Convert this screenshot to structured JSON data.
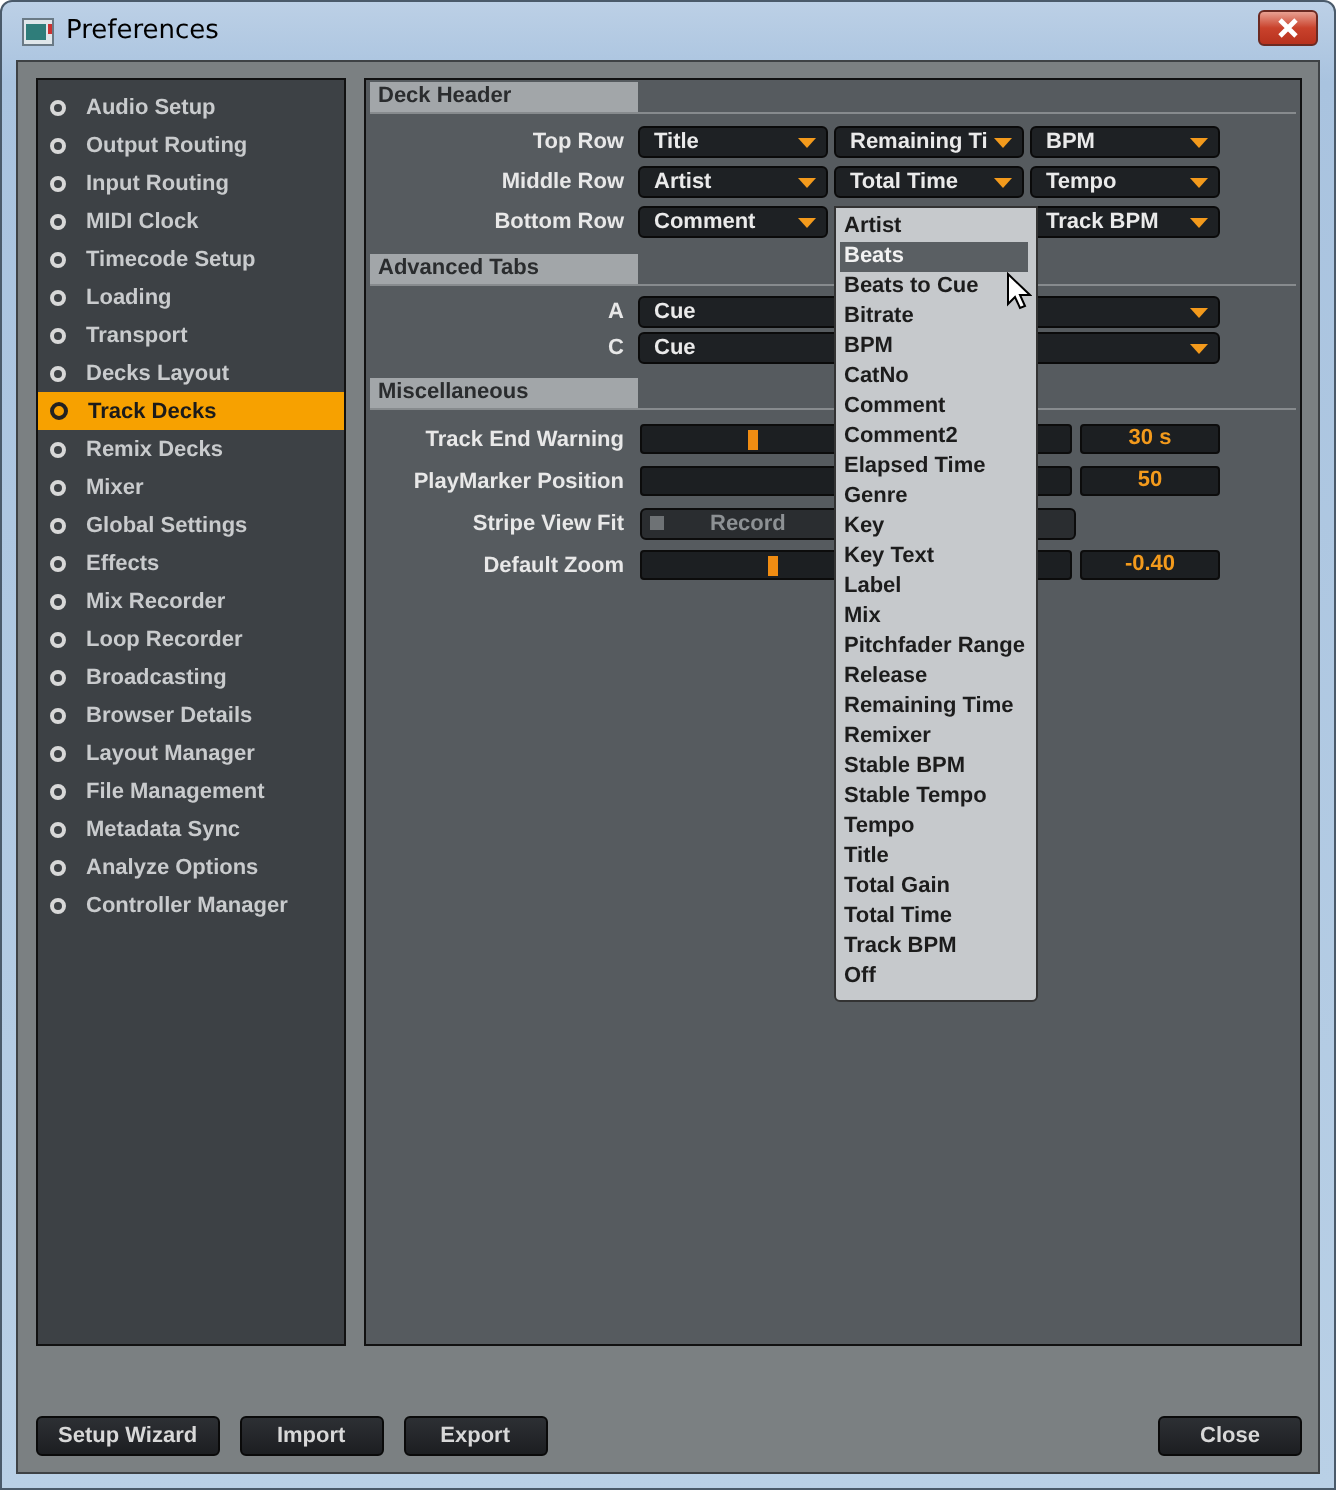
{
  "window": {
    "title": "Preferences"
  },
  "sidebar": {
    "items": [
      {
        "label": "Audio Setup",
        "selected": false
      },
      {
        "label": "Output Routing",
        "selected": false
      },
      {
        "label": "Input Routing",
        "selected": false
      },
      {
        "label": "MIDI Clock",
        "selected": false
      },
      {
        "label": "Timecode Setup",
        "selected": false
      },
      {
        "label": "Loading",
        "selected": false
      },
      {
        "label": "Transport",
        "selected": false
      },
      {
        "label": "Decks Layout",
        "selected": false
      },
      {
        "label": "Track Decks",
        "selected": true
      },
      {
        "label": "Remix Decks",
        "selected": false
      },
      {
        "label": "Mixer",
        "selected": false
      },
      {
        "label": "Global Settings",
        "selected": false
      },
      {
        "label": "Effects",
        "selected": false
      },
      {
        "label": "Mix Recorder",
        "selected": false
      },
      {
        "label": "Loop Recorder",
        "selected": false
      },
      {
        "label": "Broadcasting",
        "selected": false
      },
      {
        "label": "Browser Details",
        "selected": false
      },
      {
        "label": "Layout Manager",
        "selected": false
      },
      {
        "label": "File Management",
        "selected": false
      },
      {
        "label": "Metadata Sync",
        "selected": false
      },
      {
        "label": "Analyze Options",
        "selected": false
      },
      {
        "label": "Controller Manager",
        "selected": false
      }
    ]
  },
  "sections": [
    {
      "title": "Deck Header",
      "kind": "grid",
      "rows": [
        {
          "label": "Top Row",
          "cells": [
            {
              "kind": "select",
              "value": "Title"
            },
            {
              "kind": "select",
              "value": "Remaining Ti"
            },
            {
              "kind": "select",
              "value": "BPM"
            }
          ]
        },
        {
          "label": "Middle Row",
          "cells": [
            {
              "kind": "select",
              "value": "Artist"
            },
            {
              "kind": "select",
              "value": "Total Time"
            },
            {
              "kind": "select",
              "value": "Tempo"
            }
          ]
        },
        {
          "label": "Bottom Row",
          "cells": [
            {
              "kind": "select",
              "value": "Comment"
            },
            {
              "kind": "menu",
              "options": [
                {
                  "label": "Artist",
                  "selected": false
                },
                {
                  "label": "Beats",
                  "selected": true
                },
                {
                  "label": "Beats to Cue",
                  "selected": false
                },
                {
                  "label": "Bitrate",
                  "selected": false
                },
                {
                  "label": "BPM",
                  "selected": false
                },
                {
                  "label": "CatNo",
                  "selected": false
                },
                {
                  "label": "Comment",
                  "selected": false
                },
                {
                  "label": "Comment2",
                  "selected": false
                },
                {
                  "label": "Elapsed Time",
                  "selected": false
                },
                {
                  "label": "Genre",
                  "selected": false
                },
                {
                  "label": "Key",
                  "selected": false
                },
                {
                  "label": "Key Text",
                  "selected": false
                },
                {
                  "label": "Label",
                  "selected": false
                },
                {
                  "label": "Mix",
                  "selected": false
                },
                {
                  "label": "Pitchfader Range",
                  "selected": false
                },
                {
                  "label": "Release",
                  "selected": false
                },
                {
                  "label": "Remaining Time",
                  "selected": false
                },
                {
                  "label": "Remixer",
                  "selected": false
                },
                {
                  "label": "Stable BPM",
                  "selected": false
                },
                {
                  "label": "Stable Tempo",
                  "selected": false
                },
                {
                  "label": "Tempo",
                  "selected": false
                },
                {
                  "label": "Title",
                  "selected": false
                },
                {
                  "label": "Total Gain",
                  "selected": false
                },
                {
                  "label": "Total Time",
                  "selected": false
                },
                {
                  "label": "Track BPM",
                  "selected": false
                },
                {
                  "label": "Off",
                  "selected": false
                }
              ]
            },
            {
              "kind": "select",
              "value": "Track BPM"
            }
          ]
        }
      ]
    },
    {
      "title": "Advanced Tabs",
      "kind": "wide",
      "rows": [
        {
          "label": "A",
          "value": "Cue"
        },
        {
          "label": "C",
          "value": "Cue"
        }
      ]
    },
    {
      "title": "Miscellaneous",
      "kind": "misc",
      "rows": [
        {
          "label": "Track End Warning",
          "kind": "slider",
          "level": 0.26,
          "reading": "30 s"
        },
        {
          "label": "PlayMarker Position",
          "kind": "slider",
          "reading": "50"
        },
        {
          "label": "Stripe View Fit",
          "kind": "toggle",
          "button": "Record",
          "checked": false
        },
        {
          "label": "Default Zoom",
          "kind": "slider",
          "level": 0.31,
          "reading": "-0.40"
        }
      ]
    }
  ],
  "footer": {
    "left_buttons": [
      "Setup Wizard",
      "Import",
      "Export"
    ],
    "right_buttons": [
      "Close"
    ]
  }
}
